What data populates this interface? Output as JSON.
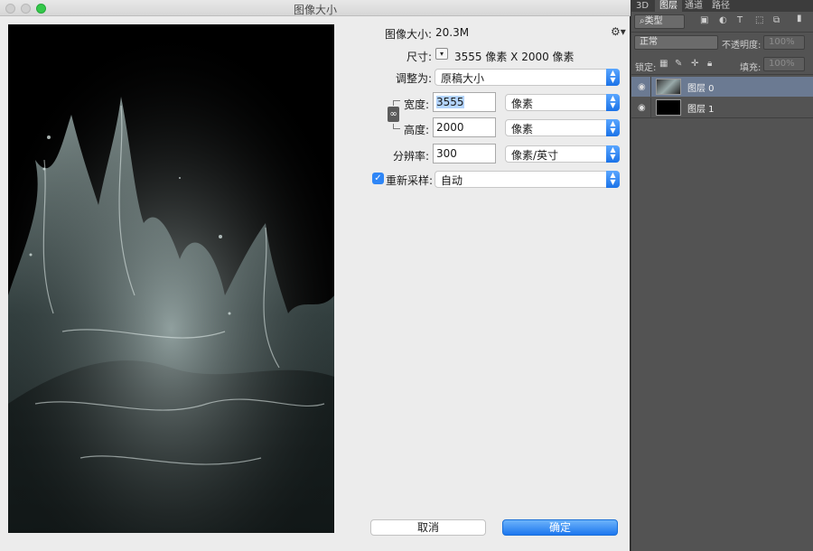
{
  "window": {
    "title": "图像大小"
  },
  "image_size": {
    "label": "图像大小:",
    "value": "20.3M"
  },
  "dimensions": {
    "label": "尺寸:",
    "value": "3555 像素  X  2000 像素"
  },
  "fit_to": {
    "label": "调整为:",
    "value": "原稿大小"
  },
  "width": {
    "label": "宽度:",
    "value": "3555",
    "unit": "像素"
  },
  "height": {
    "label": "高度:",
    "value": "2000",
    "unit": "像素"
  },
  "resolution": {
    "label": "分辨率:",
    "value": "300",
    "unit": "像素/英寸"
  },
  "resample": {
    "label": "重新采样:",
    "checked": true,
    "value": "自动"
  },
  "buttons": {
    "cancel": "取消",
    "ok": "确定"
  },
  "icons": {
    "gear": "gear-icon",
    "link": "link-icon",
    "eye": "eye-icon"
  },
  "colors": {
    "accent": "#1d77ef",
    "selected_layer": "#6b7a92",
    "panel": "#535353"
  },
  "panel": {
    "tabs": [
      "3D",
      "图层",
      "通道",
      "路径"
    ],
    "active_tab": "图层",
    "filter_label": "类型",
    "blend_mode": "正常",
    "opacity_label": "不透明度:",
    "opacity_value": "100%",
    "lock_label": "锁定:",
    "fill_label": "填充:",
    "fill_value": "100%",
    "layers": [
      {
        "name": "图层 0",
        "selected": true
      },
      {
        "name": "图层 1",
        "selected": false
      }
    ]
  }
}
